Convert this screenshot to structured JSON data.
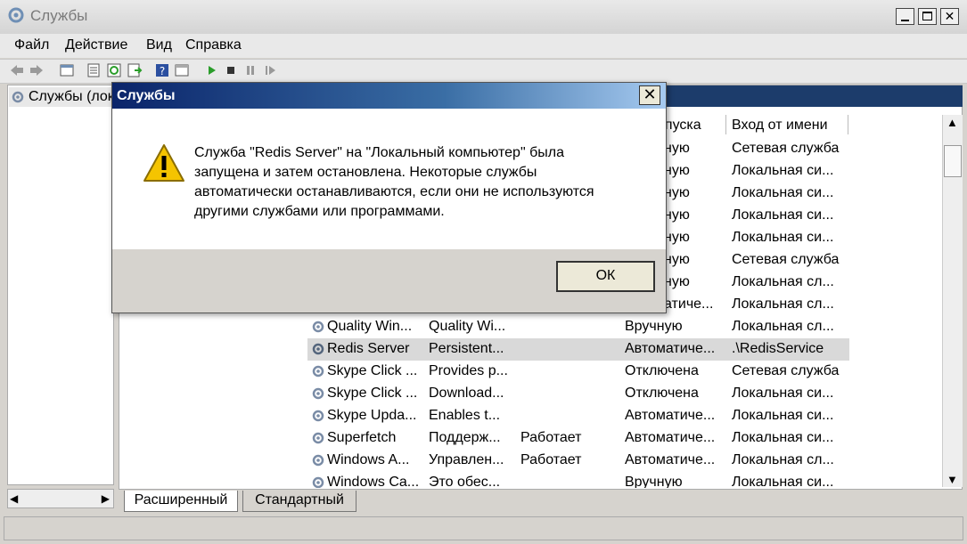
{
  "window": {
    "title": "Службы"
  },
  "menu": [
    "Файл",
    "Действие",
    "Вид",
    "Справка"
  ],
  "tree": {
    "root_label": "Службы (лок"
  },
  "list": {
    "columns": {
      "startup": "апуска",
      "logon": "Вход от имени"
    },
    "hidden_rows": [
      {
        "startup": "ную",
        "logon": "Сетевая служба"
      },
      {
        "startup": "ную",
        "logon": "Локальная си..."
      },
      {
        "startup": "ную",
        "logon": "Локальная си..."
      },
      {
        "startup": "ную",
        "logon": "Локальная си..."
      },
      {
        "startup": "ную",
        "logon": "Локальная си..."
      },
      {
        "startup": "ную",
        "logon": "Сетевая служба"
      },
      {
        "startup": "ную",
        "logon": "Локальная сл..."
      },
      {
        "startup": "атиче...",
        "logon": "Локальная сл..."
      }
    ],
    "rows": [
      {
        "name": "Quality Win...",
        "desc": "Quality Wi...",
        "status": "",
        "startup": "Вручную",
        "logon": "Локальная сл..."
      },
      {
        "name": "Redis Server",
        "desc": "Persistent...",
        "status": "",
        "startup": "Автоматиче...",
        "logon": ".\\RedisService"
      },
      {
        "name": "Skype Click ...",
        "desc": "Provides p...",
        "status": "",
        "startup": "Отключена",
        "logon": "Сетевая служба"
      },
      {
        "name": "Skype Click ...",
        "desc": "Download...",
        "status": "",
        "startup": "Отключена",
        "logon": "Локальная си..."
      },
      {
        "name": "Skype Upda...",
        "desc": "Enables t...",
        "status": "",
        "startup": "Автоматиче...",
        "logon": "Локальная си..."
      },
      {
        "name": "Superfetch",
        "desc": "Поддерж...",
        "status": "Работает",
        "startup": "Автоматиче...",
        "logon": "Локальная си..."
      },
      {
        "name": "Windows A...",
        "desc": "Управлен...",
        "status": "Работает",
        "startup": "Автоматиче...",
        "logon": "Локальная сл..."
      },
      {
        "name": "Windows Ca...",
        "desc": "Это обес...",
        "status": "",
        "startup": "Вручную",
        "logon": "Локальная си..."
      }
    ]
  },
  "tabs": [
    "Расширенный",
    "Стандартный"
  ],
  "dialog": {
    "title": "Службы",
    "close": "✕",
    "message": [
      "Служба \"Redis Server\" на \"Локальный компьютер\" была",
      "запущена и затем остановлена. Некоторые службы",
      "автоматически останавливаются, если они не используются",
      "другими службами или программами."
    ],
    "ok_label": "ОК"
  },
  "colors": {
    "accent": "#0a246a",
    "warning": "#f5c400"
  }
}
